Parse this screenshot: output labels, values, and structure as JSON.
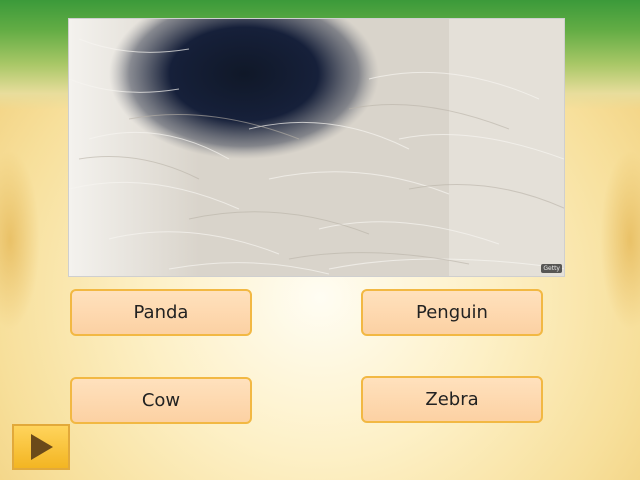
{
  "photo": {
    "credit": "Getty"
  },
  "answers": {
    "panda": "Panda",
    "penguin": "Penguin",
    "cow": "Cow",
    "zebra": "Zebra"
  },
  "controls": {
    "play_icon": "play-triangle-icon"
  },
  "colors": {
    "answer_fill": "#fcd1a3",
    "answer_border": "#f2b843",
    "play_button": "#f3b522",
    "play_triangle": "#6b4a1a",
    "top_band": "#3b9a3a"
  }
}
